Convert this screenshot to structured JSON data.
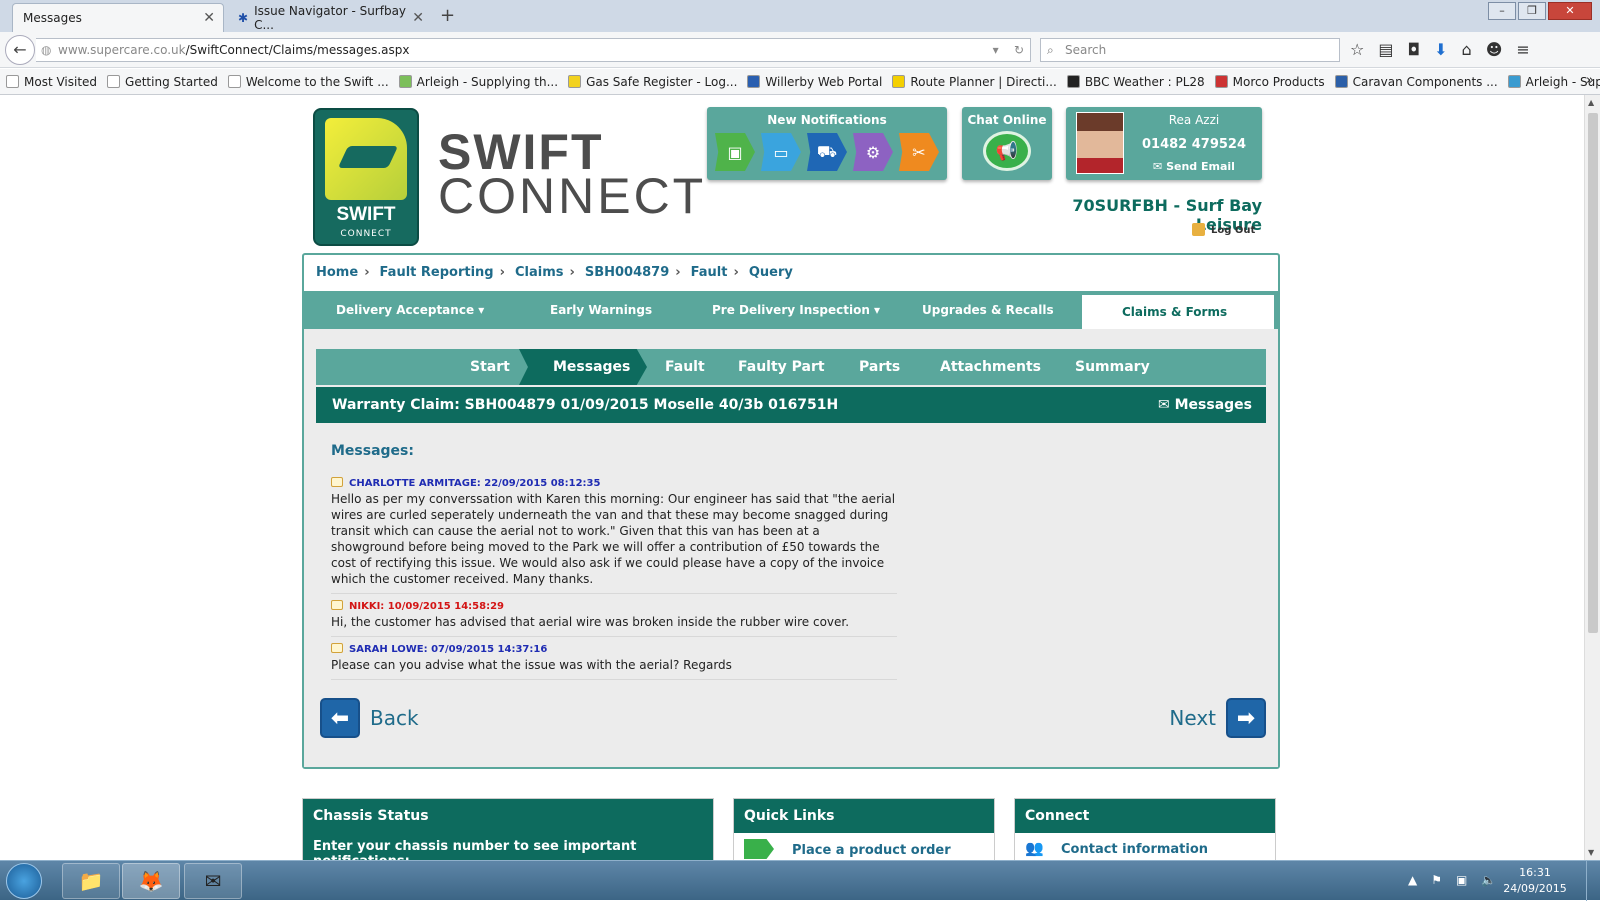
{
  "browser": {
    "tabs": [
      {
        "label": "Messages",
        "active": true
      },
      {
        "label": "Issue Navigator - Surfbay C...",
        "active": false
      }
    ],
    "url_domain": "www.supercare.co.uk",
    "url_path": "/SwiftConnect/Claims/messages.aspx",
    "search_placeholder": "Search",
    "bookmarks": [
      "Most Visited",
      "Getting Started",
      "Welcome to the Swift ...",
      "Arleigh - Supplying th...",
      "Gas Safe Register - Log...",
      "Willerby Web Portal",
      "Route Planner | Directi...",
      "BBC Weather : PL28",
      "Morco Products",
      "Caravan Components ...",
      "Arleigh - Supplying th..."
    ]
  },
  "header": {
    "logo_word": "SWIFT",
    "logo_sub": "CONNECT",
    "brand_line1": "SWIFT",
    "brand_line2": "CONNECT",
    "notifications_title": "New Notifications",
    "chat_title": "Chat Online",
    "rep_name": "Rea Azzi",
    "rep_phone": "01482 479524",
    "rep_email_label": "Send Email",
    "dealer": "70SURFBH - Surf Bay Leisure",
    "logout": "Log Out"
  },
  "breadcrumb": [
    "Home",
    "Fault Reporting",
    "Claims",
    "SBH004879",
    "Fault",
    "Query"
  ],
  "main_nav": [
    {
      "label": "Delivery Acceptance ▾"
    },
    {
      "label": "Early Warnings"
    },
    {
      "label": "Pre Delivery Inspection ▾"
    },
    {
      "label": "Upgrades & Recalls"
    },
    {
      "label": "Claims & Forms ▾",
      "active": true
    }
  ],
  "steps": [
    "Start",
    "Messages",
    "Fault",
    "Faulty Part",
    "Parts",
    "Attachments",
    "Summary"
  ],
  "claim_bar": {
    "title": "Warranty Claim: SBH004879 01/09/2015 Moselle 40/3b 016751H",
    "messages_link": "Messages"
  },
  "messages_title": "Messages:",
  "messages": [
    {
      "author": "CHARLOTTE ARMITAGE: 22/09/2015 08:12:35",
      "color": "#1f2cb3",
      "body": "Hello as per my converssation with Karen this morning: Our engineer has said that \"the aerial wires are curled seperately underneath the van and that these may become snagged during transit which can cause the aerial not to work.\" Given that this van has been at a showground before being moved to the Park we will offer a contribution of £50 towards the cost of rectifying this issue. We would also ask if we could please have a copy of the invoice which the customer received. Many thanks."
    },
    {
      "author": "NIKKI: 10/09/2015 14:58:29",
      "color": "#d31515",
      "body": "Hi, the customer has advised that aerial wire was broken inside the rubber wire cover."
    },
    {
      "author": "SARAH LOWE: 07/09/2015 14:37:16",
      "color": "#1f2cb3",
      "body": "Please can you advise what the issue was with the aerial? Regards"
    }
  ],
  "buttons": {
    "back": "Back",
    "next": "Next"
  },
  "bottom": {
    "chassis_title": "Chassis Status",
    "chassis_prompt": "Enter your chassis number to see important notifications:",
    "quicklinks_title": "Quick Links",
    "quicklinks_item": "Place a product order",
    "connect_title": "Connect",
    "connect_item": "Contact information"
  },
  "taskbar": {
    "time": "16:31",
    "date": "24/09/2015"
  }
}
